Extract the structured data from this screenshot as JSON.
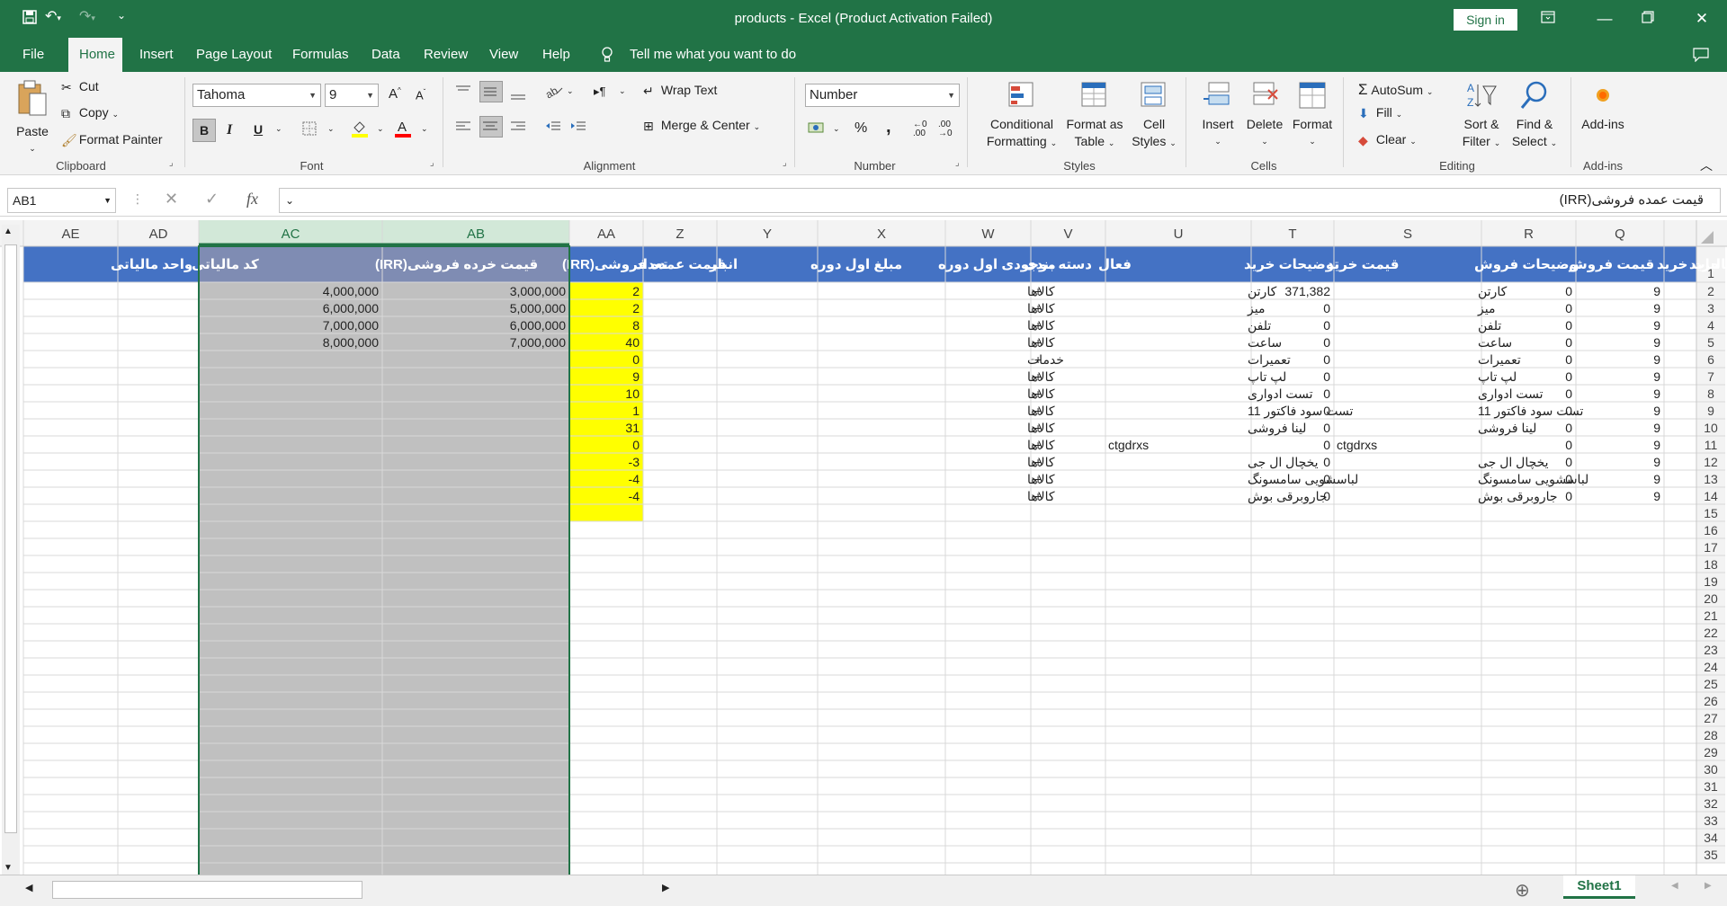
{
  "window": {
    "title": "products  -  Excel (Product Activation Failed)",
    "sign_in": "Sign in"
  },
  "tabs": [
    "File",
    "Home",
    "Insert",
    "Page Layout",
    "Formulas",
    "Data",
    "Review",
    "View",
    "Help"
  ],
  "active_tab": "Home",
  "tell_me": "Tell me what you want to do",
  "ribbon": {
    "clipboard": {
      "paste": "Paste",
      "cut": "Cut",
      "copy": "Copy",
      "format_painter": "Format Painter",
      "label": "Clipboard"
    },
    "font": {
      "font_name": "Tahoma",
      "font_size": "9",
      "bold": "B",
      "italic": "I",
      "underline": "U",
      "label": "Font"
    },
    "alignment": {
      "wrap_text": "Wrap Text",
      "merge_center": "Merge & Center",
      "label": "Alignment"
    },
    "number": {
      "format": "Number",
      "percent": "%",
      "comma": ",",
      "label": "Number"
    },
    "styles": {
      "conditional": "Conditional",
      "conditional2": "Formatting",
      "format_as": "Format as",
      "format_as2": "Table",
      "cell": "Cell",
      "cell2": "Styles",
      "label": "Styles"
    },
    "cells": {
      "insert": "Insert",
      "delete": "Delete",
      "format": "Format",
      "label": "Cells"
    },
    "editing": {
      "autosum": "AutoSum",
      "fill": "Fill",
      "clear": "Clear",
      "sort": "Sort &",
      "sort2": "Filter",
      "find": "Find &",
      "find2": "Select",
      "label": "Editing"
    },
    "addins": {
      "addins": "Add-ins",
      "label": "Add-ins"
    }
  },
  "formula_bar": {
    "name_box": "AB1",
    "fx": "fx",
    "value": "قیمت عمده فروشی(IRR)"
  },
  "sheet": {
    "columns": [
      "AE",
      "AD",
      "AC",
      "AB",
      "AA",
      "Z",
      "Y",
      "X",
      "W",
      "V",
      "U",
      "T",
      "S",
      "R",
      "Q"
    ],
    "header_row": [
      "واحد مالیاتی",
      "کد مالیاتی",
      "قیمت خرده فروشی(IRR)",
      "قیمت عمده فروشی(IRR)",
      "تعداد",
      "انبار",
      "مبلغ اول دوره",
      "موجودی اول دوره",
      "دسته بندی",
      "فعال",
      "توضیحات خرید",
      "قیمت خرید",
      "توضیحات فروش",
      "قیمت فروش",
      "مالیات خرید",
      "حرید"
    ],
    "rows": [
      {
        "AC": "4,000,000",
        "AB": "3,000,000",
        "AA": "2",
        "W": "کالاها",
        "V": "+",
        "U": "کارتن",
        "T": "371,382",
        "S": "کارتن",
        "R": "0",
        "Q": "9"
      },
      {
        "AC": "6,000,000",
        "AB": "5,000,000",
        "AA": "2",
        "W": "کالاها",
        "V": "+",
        "U": "میز",
        "T": "0",
        "S": "میز",
        "R": "0",
        "Q": "9"
      },
      {
        "AC": "7,000,000",
        "AB": "6,000,000",
        "AA": "8",
        "W": "کالاها",
        "V": "+",
        "U": "تلفن",
        "T": "0",
        "S": "تلفن",
        "R": "0",
        "Q": "9"
      },
      {
        "AC": "8,000,000",
        "AB": "7,000,000",
        "AA": "40",
        "W": "کالاها",
        "V": "+",
        "U": "ساعت",
        "T": "0",
        "S": "ساعت",
        "R": "0",
        "Q": "9"
      },
      {
        "AA": "0",
        "W": "خدمات",
        "V": "+",
        "U": "تعمیرات",
        "T": "0",
        "S": "تعمیرات",
        "R": "0",
        "Q": "9"
      },
      {
        "AA": "9",
        "W": "کالاها",
        "V": "+",
        "U": "لپ تاپ",
        "T": "0",
        "S": "لپ تاپ",
        "R": "0",
        "Q": "9"
      },
      {
        "AA": "10",
        "W": "کالاها",
        "V": "+",
        "U": "تست ادواری",
        "T": "0",
        "S": "تست ادواری",
        "R": "0",
        "Q": "9"
      },
      {
        "AA": "1",
        "W": "کالاها",
        "V": "+",
        "U": "تست سود فاکتور 11",
        "T": "0",
        "S": "تست سود فاکتور 11",
        "R": "0",
        "Q": "9"
      },
      {
        "AA": "31",
        "W": "کالاها",
        "V": "+",
        "U": "لینا فروشی",
        "T": "0",
        "S": "لینا فروشی",
        "R": "0",
        "Q": "9"
      },
      {
        "AA": "0",
        "W": "کالاها",
        "V": "+",
        "U": "ctgdrxs",
        "T": "0",
        "S": "ctgdrxs",
        "R": "0",
        "Q": "9"
      },
      {
        "AA": "-3",
        "W": "کالاها",
        "V": "+",
        "U": "یخچال ال جی",
        "T": "0",
        "S": "یخچال ال جی",
        "R": "0",
        "Q": "9"
      },
      {
        "AA": "-4",
        "W": "کالاها",
        "V": "+",
        "U": "لباسشویی سامسونگ",
        "T": "0",
        "S": "لباسشویی سامسونگ",
        "R": "0",
        "Q": "9"
      },
      {
        "AA": "-4",
        "W": "کالاها",
        "V": "+",
        "U": "جاروبرقی بوش",
        "T": "0",
        "S": "جاروبرقی بوش",
        "R": "0",
        "Q": "9"
      }
    ],
    "row_count": 35,
    "sheet_tab": "Sheet1"
  },
  "colors": {
    "excel_green": "#217346",
    "header_fill": "#4472c4",
    "yellow": "#ffff00",
    "selection_gray": "#c0c0c0"
  }
}
